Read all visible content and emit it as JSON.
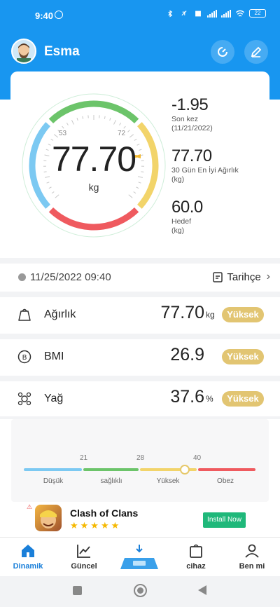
{
  "status": {
    "time": "9:40",
    "battery": "22"
  },
  "header": {
    "username": "Esma"
  },
  "gauge": {
    "value": "77.70",
    "unit": "kg",
    "tick_low": "53",
    "tick_high": "72"
  },
  "stats": {
    "last": {
      "value": "-1.95",
      "label": "Son kez",
      "sub": "(11/21/2022)"
    },
    "best": {
      "value": "77.70",
      "label": "30 Gün En İyi Ağırlık",
      "sub": "(kg)"
    },
    "goal": {
      "value": "60.0",
      "label": "Hedef",
      "sub": "(kg)"
    }
  },
  "measurement": {
    "datetime": "11/25/2022 09:40",
    "history_label": "Tarihçe"
  },
  "metrics": [
    {
      "name": "Ağırlık",
      "value": "77.70",
      "unit": "kg",
      "status": "Yüksek"
    },
    {
      "name": "BMI",
      "value": "26.9",
      "unit": "",
      "status": "Yüksek"
    },
    {
      "name": "Yağ",
      "value": "37.6",
      "unit": "%",
      "status": "Yüksek"
    }
  ],
  "scale": {
    "thresholds": [
      "21",
      "28",
      "40"
    ],
    "labels": [
      "Düşük",
      "sağlıklı",
      "Yüksek",
      "Obez"
    ]
  },
  "ad": {
    "app_name": "Clash of Clans",
    "stars": "★★★★★",
    "install_label": "Install Now"
  },
  "tabs": [
    {
      "label": "Dinamik",
      "active": true
    },
    {
      "label": "Güncel"
    },
    {
      "label": "cihaz"
    },
    {
      "label": "Ben mi"
    }
  ],
  "colors": {
    "brand_blue": "#1896f0",
    "gauge_green": "#6cc46a",
    "gauge_yellow": "#f2d46a",
    "gauge_red": "#ef5a5f",
    "gauge_lightblue": "#7cc9f2",
    "badge_gold": "#e2c572"
  }
}
